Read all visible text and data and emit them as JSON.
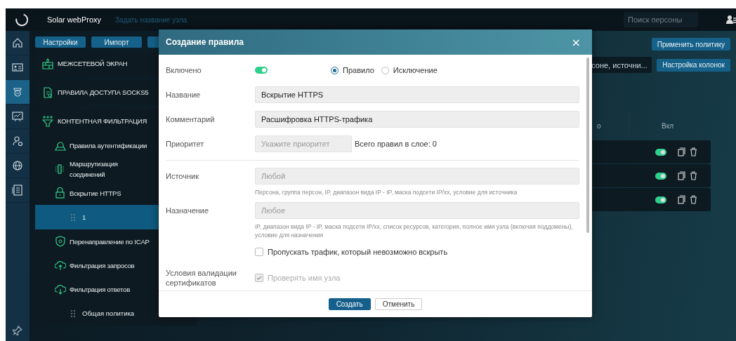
{
  "header": {
    "product": "Solar webProxy",
    "node_name_link": "Задать название узла",
    "search": {
      "placeholder": "Поиск персоны"
    }
  },
  "rail": {
    "items": [
      {
        "selected": false
      },
      {
        "selected": false
      },
      {
        "selected": true
      },
      {
        "selected": false
      },
      {
        "selected": false
      },
      {
        "selected": false
      },
      {
        "selected": false
      }
    ]
  },
  "toolbar": {
    "buttons": [
      "Настройки",
      "Импорт"
    ]
  },
  "nav": {
    "sections": [
      {
        "label": "МЕЖСЕТЕВОЙ ЭКРАН"
      },
      {
        "label": "ПРАВИЛА ДОСТУПА SOCKS5"
      },
      {
        "label": "КОНТЕНТНАЯ ФИЛЬТРАЦИЯ",
        "children": [
          {
            "label": "Правила аутентификации"
          },
          {
            "label": "Маршрутизация соединений"
          },
          {
            "label": "Вскрытие HTTPS",
            "children": [
              {
                "label": "1",
                "selected": true
              }
            ]
          },
          {
            "label": "Перенаправление по ICAP"
          },
          {
            "label": "Фильтрация запросов"
          },
          {
            "label": "Фильтрация ответов",
            "children": [
              {
                "label": "Общая политика",
                "selected": false
              }
            ]
          }
        ]
      }
    ]
  },
  "rules_view": {
    "apply_button": "Применить политику",
    "filter": {
      "value": "соне, источни..."
    },
    "columns_button": "Настройка колонок",
    "table": {
      "columns": [
        "о",
        "Вкл"
      ],
      "rows": [
        {
          "enabled": true
        },
        {
          "enabled": true
        },
        {
          "enabled": true
        }
      ]
    }
  },
  "dialog": {
    "title": "Создание правила",
    "close": "×",
    "enabled": {
      "label": "Включено",
      "on": true
    },
    "rule_type": [
      {
        "label": "Правило",
        "selected": true
      },
      {
        "label": "Исключение",
        "selected": false
      }
    ],
    "name": {
      "label": "Название",
      "value": "Вскрытие HTTPS"
    },
    "comment": {
      "label": "Комментарий",
      "value": "Расшифровка HTTPS-трафика"
    },
    "priority": {
      "label": "Приоритет",
      "placeholder": "Укажите приоритет",
      "note": "Всего правил в слое: 0"
    },
    "source": {
      "label": "Источник",
      "placeholder": "Любой",
      "hint": "Персона, группа персон, IP, диапазон вида IP - IP, маска подсети IP/xx, условие для источника"
    },
    "destination": {
      "label": "Назначение",
      "placeholder": "Любое",
      "hint": "IP, диапазон вида IP - IP, маска подсети IP/xx, список ресурсов, категория, полное имя узла (включая поддомены), условие для назначения"
    },
    "skip_undecryptable": {
      "label": "Пропускать трафик, который невозможно вскрыть",
      "checked": false
    },
    "cert_validation": {
      "label": "Условия валидации сертификатов",
      "option": {
        "label": "Проверять имя узла",
        "checked": true,
        "disabled": true
      }
    },
    "buttons": {
      "create": "Создать",
      "cancel": "Отменить"
    }
  }
}
